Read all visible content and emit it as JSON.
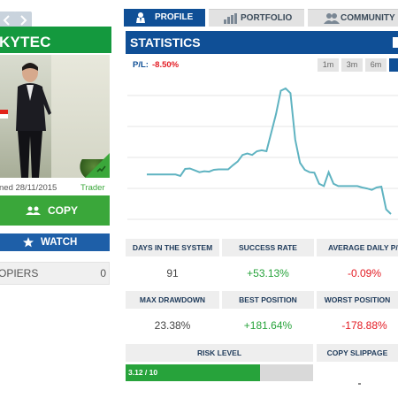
{
  "profile": {
    "name": "KYTEC",
    "joined": "ned 28/11/2015",
    "role": "Trader",
    "copy_label": "COPY",
    "watch_label": "WATCH",
    "copiers_label": "OPIERS",
    "copiers_count": "0"
  },
  "tabs": [
    {
      "label": "PROFILE",
      "icon": "profile-icon",
      "active": true
    },
    {
      "label": "PORTFOLIO",
      "icon": "bar-chart-icon",
      "active": false
    },
    {
      "label": "COMMUNITY",
      "icon": "users-icon",
      "active": false
    }
  ],
  "statistics": {
    "title": "STATISTICS",
    "pl_label": "P/L:",
    "pl_value": "-8.50%",
    "ranges": [
      "1m",
      "3m",
      "6m",
      ""
    ],
    "active_range_index": 3
  },
  "chart_data": {
    "type": "line",
    "series": [
      {
        "color": "#5fb3c1",
        "values": [
          0.0,
          0.0,
          0.0,
          0.0,
          0.0,
          0.0,
          0.0,
          -0.3,
          1.2,
          1.3,
          0.9,
          0.5,
          0.7,
          0.6,
          1.0,
          1.1,
          1.1,
          1.1,
          2.0,
          2.8,
          4.2,
          4.5,
          4.2,
          5.0,
          5.2,
          5.0,
          9.0,
          13.0,
          18.0,
          18.5,
          17.5,
          7.5,
          2.5,
          1.0,
          0.5,
          0.4,
          -2.0,
          -2.5,
          0.5,
          -2.0,
          -2.5,
          -2.5,
          -2.5,
          -2.5,
          -2.5,
          -2.8,
          -3.0,
          -3.3,
          -2.8,
          -2.6,
          -7.5,
          -8.5
        ]
      }
    ],
    "grid": true,
    "legend": "none"
  },
  "stats": [
    {
      "label": "DAYS IN THE SYSTEM",
      "value": "91",
      "tone": "neu"
    },
    {
      "label": "SUCCESS RATE",
      "value": "+53.13%",
      "tone": "pos"
    },
    {
      "label": "AVERAGE DAILY P/L",
      "value": "-0.09%",
      "tone": "neg"
    },
    {
      "label": "MAX DRAWDOWN",
      "value": "23.38%",
      "tone": "neu"
    },
    {
      "label": "BEST POSITION",
      "value": "+181.64%",
      "tone": "pos"
    },
    {
      "label": "WORST POSITION",
      "value": "-178.88%",
      "tone": "neg"
    }
  ],
  "risk": {
    "label": "RISK LEVEL",
    "value_text": "3.12 / 10",
    "level": 3.12,
    "max": 10
  },
  "copy_slippage": {
    "label": "COPY SLIPPAGE"
  },
  "colors": {
    "brand_blue": "#0f4f96",
    "green": "#3aa73a",
    "red": "#e31b23",
    "line": "#5fb3c1"
  }
}
